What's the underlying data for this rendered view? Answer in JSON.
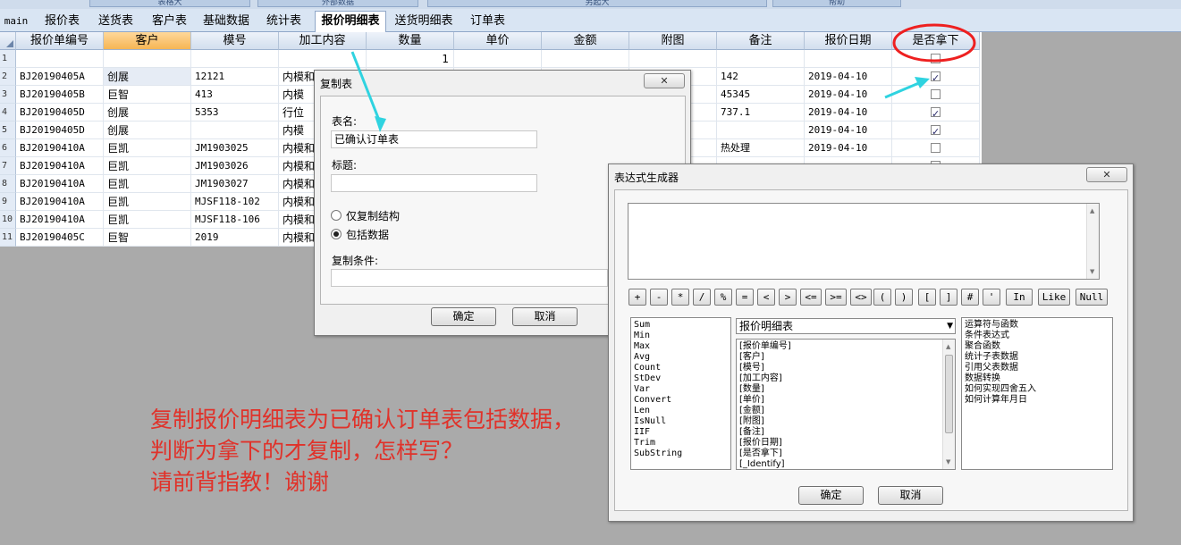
{
  "top_strip": [
    "表格大",
    "外部数据",
    "另起大",
    "帮助"
  ],
  "tabs": [
    "main",
    "报价表",
    "送货表",
    "客户表",
    "基础数据",
    "统计表",
    "报价明细表",
    "送货明细表",
    "订单表"
  ],
  "grid": {
    "columns": [
      "报价单编号",
      "客户",
      "模号",
      "加工内容",
      "数量",
      "单价",
      "金额",
      "附图",
      "备注",
      "报价日期",
      "是否拿下"
    ],
    "rows": [
      {
        "n": "1",
        "id": "",
        "cust": "",
        "mold": "",
        "proc": "",
        "qty": "1",
        "note": "",
        "date": "",
        "chk": false
      },
      {
        "n": "2",
        "id": "BJ20190405A",
        "cust": "创展",
        "mold": "12121",
        "proc": "内模和",
        "qty": "",
        "note": "142",
        "date": "2019-04-10",
        "chk": true
      },
      {
        "n": "3",
        "id": "BJ20190405B",
        "cust": "巨智",
        "mold": "413",
        "proc": "内模",
        "qty": "",
        "note": "45345",
        "date": "2019-04-10",
        "chk": false
      },
      {
        "n": "4",
        "id": "BJ20190405D",
        "cust": "创展",
        "mold": "5353",
        "proc": "行位",
        "qty": "",
        "note": "737.1",
        "date": "2019-04-10",
        "chk": true
      },
      {
        "n": "5",
        "id": "BJ20190405D",
        "cust": "创展",
        "mold": "",
        "proc": "内模",
        "qty": "",
        "note": "",
        "date": "2019-04-10",
        "chk": true
      },
      {
        "n": "6",
        "id": "BJ20190410A",
        "cust": "巨凯",
        "mold": "JM1903025",
        "proc": "内模和",
        "qty": "",
        "note": "热处理",
        "date": "2019-04-10",
        "chk": false
      },
      {
        "n": "7",
        "id": "BJ20190410A",
        "cust": "巨凯",
        "mold": "JM1903026",
        "proc": "内模和",
        "qty": "",
        "note": "",
        "date": "",
        "chk": false
      },
      {
        "n": "8",
        "id": "BJ20190410A",
        "cust": "巨凯",
        "mold": "JM1903027",
        "proc": "内模和",
        "qty": "",
        "note": "",
        "date": "",
        "chk": false
      },
      {
        "n": "9",
        "id": "BJ20190410A",
        "cust": "巨凯",
        "mold": "MJSF118-102",
        "proc": "内模和",
        "qty": "",
        "note": "",
        "date": "",
        "chk": false
      },
      {
        "n": "10",
        "id": "BJ20190410A",
        "cust": "巨凯",
        "mold": "MJSF118-106",
        "proc": "内模和",
        "qty": "",
        "note": "",
        "date": "",
        "chk": false
      },
      {
        "n": "11",
        "id": "BJ20190405C",
        "cust": "巨智",
        "mold": "2019",
        "proc": "内模和",
        "qty": "",
        "note": "",
        "date": "",
        "chk": false
      }
    ]
  },
  "copy_dialog": {
    "title": "复制表",
    "table_name_label": "表名:",
    "table_name_value": "已确认订单表",
    "caption_label": "标题:",
    "caption_value": "",
    "radio_structure": "仅复制结构",
    "radio_data": "包括数据",
    "condition_label": "复制条件:",
    "condition_value": "",
    "ok": "确定",
    "cancel": "取消"
  },
  "expr_dialog": {
    "title": "表达式生成器",
    "expression": "",
    "operators": [
      "+",
      "-",
      "*",
      "/",
      "%",
      "=",
      "<",
      ">",
      "<=",
      ">=",
      "<>",
      "(",
      ")",
      "[",
      "]",
      "#",
      "'",
      "In",
      "Like",
      "Null"
    ],
    "functions": [
      "Sum",
      "Min",
      "Max",
      "Avg",
      "Count",
      "StDev",
      "Var",
      "Convert",
      "Len",
      "IsNull",
      "IIF",
      "Trim",
      "SubString"
    ],
    "table_select": "报价明细表",
    "fields": [
      "[报价单编号]",
      "[客户]",
      "[模号]",
      "[加工内容]",
      "[数量]",
      "[单价]",
      "[金额]",
      "[附图]",
      "[备注]",
      "[报价日期]",
      "[是否拿下]",
      "[_Identify]"
    ],
    "help_topics": [
      "运算符与函数",
      "条件表达式",
      "聚合函数",
      "统计子表数据",
      "引用父表数据",
      "数据转换",
      "如何实现四舍五入",
      "如何计算年月日"
    ],
    "ok": "确定",
    "cancel": "取消"
  },
  "annotation": {
    "line1": "复制报价明细表为已确认订单表包括数据，",
    "line2": "判断为拿下的才复制，怎样写？",
    "line3": "请前背指教！谢谢",
    "color": "#e0322a"
  }
}
